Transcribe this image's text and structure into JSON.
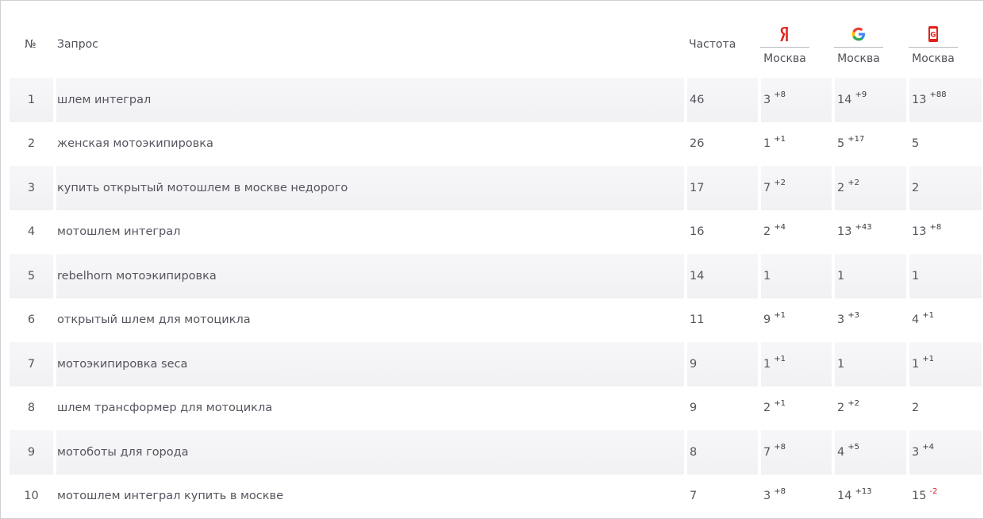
{
  "header": {
    "num": "№",
    "query": "Запрос",
    "freq": "Частота",
    "engines": [
      {
        "icon": "yandex-icon",
        "city": "Москва",
        "color": "#e2201a"
      },
      {
        "icon": "google-icon",
        "city": "Москва"
      },
      {
        "icon": "mobile-google-icon",
        "city": "Москва",
        "color": "#e2201a"
      }
    ]
  },
  "rows": [
    {
      "n": "1",
      "q": "шлем интеграл",
      "f": "46",
      "y": "3",
      "yd": "+8",
      "g": "14",
      "gd": "+9",
      "m": "13",
      "md": "+88"
    },
    {
      "n": "2",
      "q": "женская мотоэкипировка",
      "f": "26",
      "y": "1",
      "yd": "+1",
      "g": "5",
      "gd": "+17",
      "m": "5",
      "md": ""
    },
    {
      "n": "3",
      "q": "купить открытый мотошлем в москве недорого",
      "f": "17",
      "y": "7",
      "yd": "+2",
      "g": "2",
      "gd": "+2",
      "m": "2",
      "md": ""
    },
    {
      "n": "4",
      "q": "мотошлем интеграл",
      "f": "16",
      "y": "2",
      "yd": "+4",
      "g": "13",
      "gd": "+43",
      "m": "13",
      "md": "+8"
    },
    {
      "n": "5",
      "q": "rebelhorn мотоэкипировка",
      "f": "14",
      "y": "1",
      "yd": "",
      "g": "1",
      "gd": "",
      "m": "1",
      "md": ""
    },
    {
      "n": "6",
      "q": "открытый шлем для мотоцикла",
      "f": "11",
      "y": "9",
      "yd": "+1",
      "g": "3",
      "gd": "+3",
      "m": "4",
      "md": "+1"
    },
    {
      "n": "7",
      "q": "мотоэкипировка seca",
      "f": "9",
      "y": "1",
      "yd": "+1",
      "g": "1",
      "gd": "",
      "m": "1",
      "md": "+1"
    },
    {
      "n": "8",
      "q": "шлем трансформер для мотоцикла",
      "f": "9",
      "y": "2",
      "yd": "+1",
      "g": "2",
      "gd": "+2",
      "m": "2",
      "md": ""
    },
    {
      "n": "9",
      "q": "мотоботы для города",
      "f": "8",
      "y": "7",
      "yd": "+8",
      "g": "4",
      "gd": "+5",
      "m": "3",
      "md": "+4"
    },
    {
      "n": "10",
      "q": "мотошлем интеграл купить в москве",
      "f": "7",
      "y": "3",
      "yd": "+8",
      "g": "14",
      "gd": "+13",
      "m": "15",
      "md": "-2"
    }
  ]
}
